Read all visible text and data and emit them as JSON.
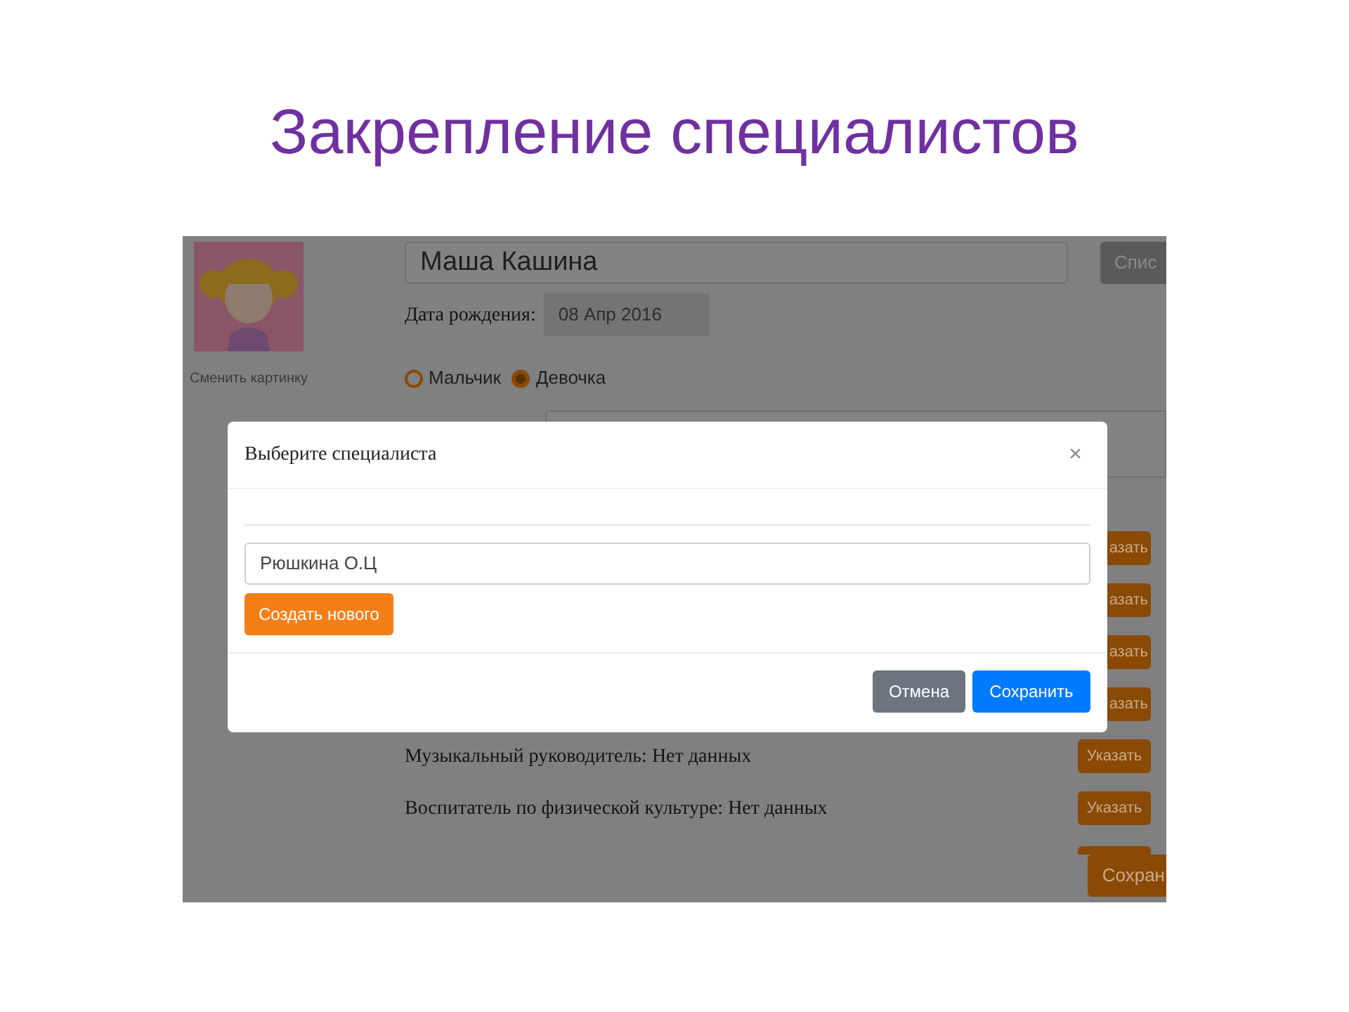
{
  "slide_title": "Закрепление специалистов",
  "page": {
    "change_picture": "Сменить картинку",
    "name": "Маша Кашина",
    "list_button": "Спис",
    "birth_label": "Дата рождения:",
    "birth_date": "08 Апр 2016",
    "gender": [
      {
        "label": "Мальчик",
        "selected": false
      },
      {
        "label": "Девочка",
        "selected": true
      }
    ],
    "rows": [
      {
        "kind": "covered",
        "button": "азать"
      },
      {
        "kind": "covered",
        "button": "азать"
      },
      {
        "kind": "covered",
        "button": "азать"
      },
      {
        "kind": "covered",
        "button": "азать"
      },
      {
        "kind": "full",
        "text": "Музыкальный руководитель: Нет данных",
        "button": "Указать"
      },
      {
        "kind": "full",
        "text": "Воспитатель по физической культуре: Нет данных",
        "button": "Указать"
      },
      {
        "kind": "edge"
      }
    ],
    "save_button": "Сохран"
  },
  "modal": {
    "title": "Выберите специалиста",
    "close": "×",
    "search_value": "Рюшкина О.Ц",
    "create_button": "Создать нового",
    "cancel_button": "Отмена",
    "save_button": "Сохранить"
  }
}
